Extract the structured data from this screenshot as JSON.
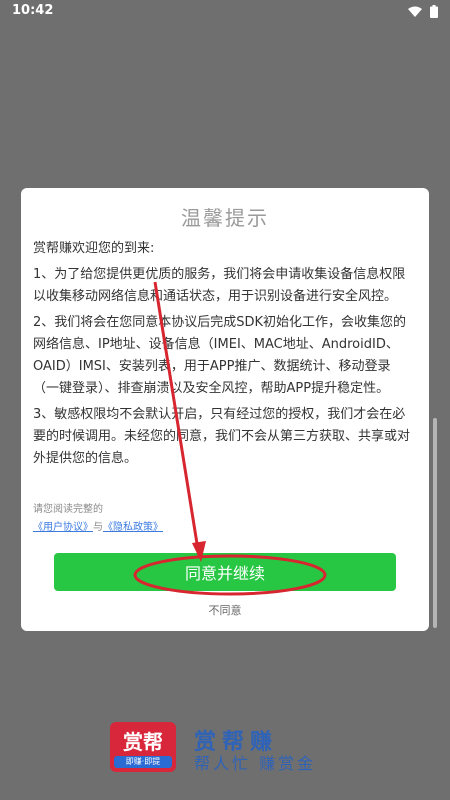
{
  "status_bar": {
    "time": "10:42"
  },
  "dialog": {
    "title": "温馨提示",
    "greeting": "赏帮赚欢迎您的到来:",
    "paragraphs": [
      "1、为了给您提供更优质的服务，我们将会申请收集设备信息权限以收集移动网络信息和通话状态，用于识别设备进行安全风控。",
      "2、我们将会在您同意本协议后完成SDK初始化工作，会收集您的网络信息、IP地址、设备信息（IMEI、MAC地址、AndroidID、OAID）IMSI、安装列表，用于APP推广、数据统计、移动登录（一键登录）、排查崩溃以及安全风控，帮助APP提升稳定性。",
      "3、敏感权限均不会默认开启，只有经过您的授权，我们才会在必要的时候调用。未经您的同意，我们不会从第三方获取、共享或对外提供您的信息。"
    ],
    "read_hint": "请您阅读完整的",
    "user_agreement": "《用户协议》",
    "link_joiner": "与",
    "privacy_policy": "《隐私政策》",
    "agree_label": "同意并继续",
    "disagree_label": "不同意"
  },
  "brand": {
    "logo_text": "赏帮",
    "logo_sub": "即赚·即提",
    "name": "赏帮赚",
    "tagline": "帮人忙 赚赏金"
  },
  "colors": {
    "accent": "#27c744",
    "annotation": "#d7262f",
    "brand_blue": "#2f63b8",
    "link": "#3b7be0"
  }
}
